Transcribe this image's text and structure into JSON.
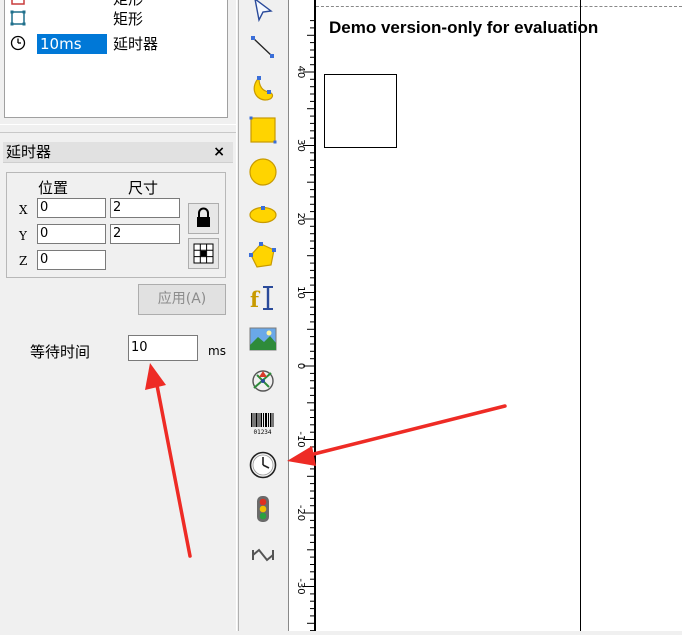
{
  "object_list": {
    "rows": [
      {
        "name": "",
        "type": "矩形",
        "icon": "rect-icon",
        "selected": false
      },
      {
        "name": "",
        "type": "矩形",
        "icon": "rect-icon",
        "selected": false
      },
      {
        "name": "10ms",
        "type": "延时器",
        "icon": "clock-icon",
        "selected": true
      }
    ]
  },
  "properties": {
    "title": "延时器",
    "close": "×",
    "position_header": "位置",
    "size_header": "尺寸",
    "axis_x": "X",
    "axis_y": "Y",
    "axis_z": "Z",
    "pos_x": "0",
    "pos_y": "0",
    "pos_z": "0",
    "size_x": "2",
    "size_y": "2",
    "apply_label": "应用(A)",
    "wait_label": "等待时间",
    "wait_value": "10",
    "wait_unit": "ms"
  },
  "toolbar": {
    "tools": [
      "select-arrow-icon",
      "line-icon",
      "curve-icon",
      "rectangle-icon",
      "circle-icon",
      "ellipse-icon",
      "polygon-icon",
      "text-icon",
      "image-icon",
      "vector-file-icon",
      "barcode-icon",
      "delay-clock-icon",
      "traffic-light-icon",
      "hourglass-icon"
    ],
    "barcode_digits": "01234"
  },
  "ruler": {
    "labels": [
      "40",
      "30",
      "20",
      "10",
      "0",
      "-10",
      "-20",
      "-30"
    ]
  },
  "canvas": {
    "watermark": "Demo version-only for evaluation"
  },
  "colors": {
    "selection": "#0078d7",
    "shape_fill": "#ffd400",
    "shape_stroke": "#c89a00",
    "annotation": "#ee2b25"
  }
}
